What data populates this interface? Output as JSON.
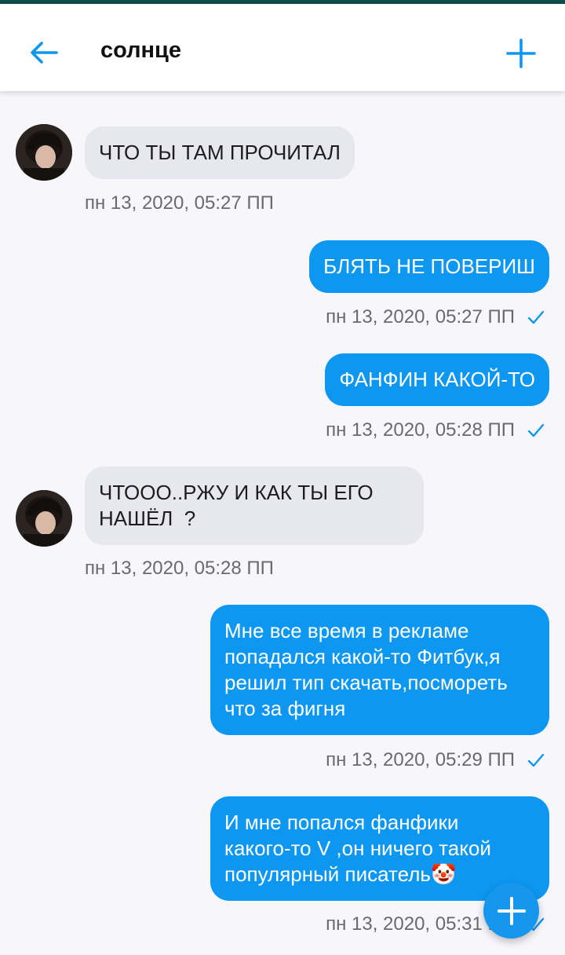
{
  "header": {
    "title": "солнце",
    "back_icon": "arrow-left-icon",
    "add_icon": "plus-icon"
  },
  "colors": {
    "accent": "#0d97f1",
    "status_strip": "#0d4d4b",
    "incoming_bubble": "#e7e7ef",
    "background": "#f7f6fa",
    "timestamp": "#6a6a6a"
  },
  "messages": [
    {
      "direction": "incoming",
      "text": "ЧТО ТЫ ТАМ ПРОЧИТАЛ",
      "time": "пн 13, 2020, 05:27 ПП"
    },
    {
      "direction": "outgoing",
      "text": "БЛЯТЬ НЕ ПОВЕРИШ",
      "time": "пн 13, 2020, 05:27 ПП",
      "read_icon": "check-icon"
    },
    {
      "direction": "outgoing",
      "text": "ФАНФИН КАКОЙ-ТО",
      "time": "пн 13, 2020, 05:28 ПП",
      "read_icon": "check-icon"
    },
    {
      "direction": "incoming",
      "text": "ЧТООО..РЖУ И КАК ТЫ ЕГО\nНАШЁЛ  ?",
      "time": "пн 13, 2020, 05:28 ПП"
    },
    {
      "direction": "outgoing",
      "text": "Мне все время в рекламе\nпопадался какой-то Фитбук,я\nрешил тип скачать,посмореть\nчто за фигня",
      "time": "пн 13, 2020, 05:29 ПП",
      "read_icon": "check-icon"
    },
    {
      "direction": "outgoing",
      "text": "И мне попался фанфики\nкакого-то V ,он ничего такой\nпопулярный писатель🤡",
      "time": "пн 13, 2020, 05:31 ПП",
      "read_icon": "check-icon"
    }
  ],
  "fab": {
    "icon": "plus-icon"
  }
}
